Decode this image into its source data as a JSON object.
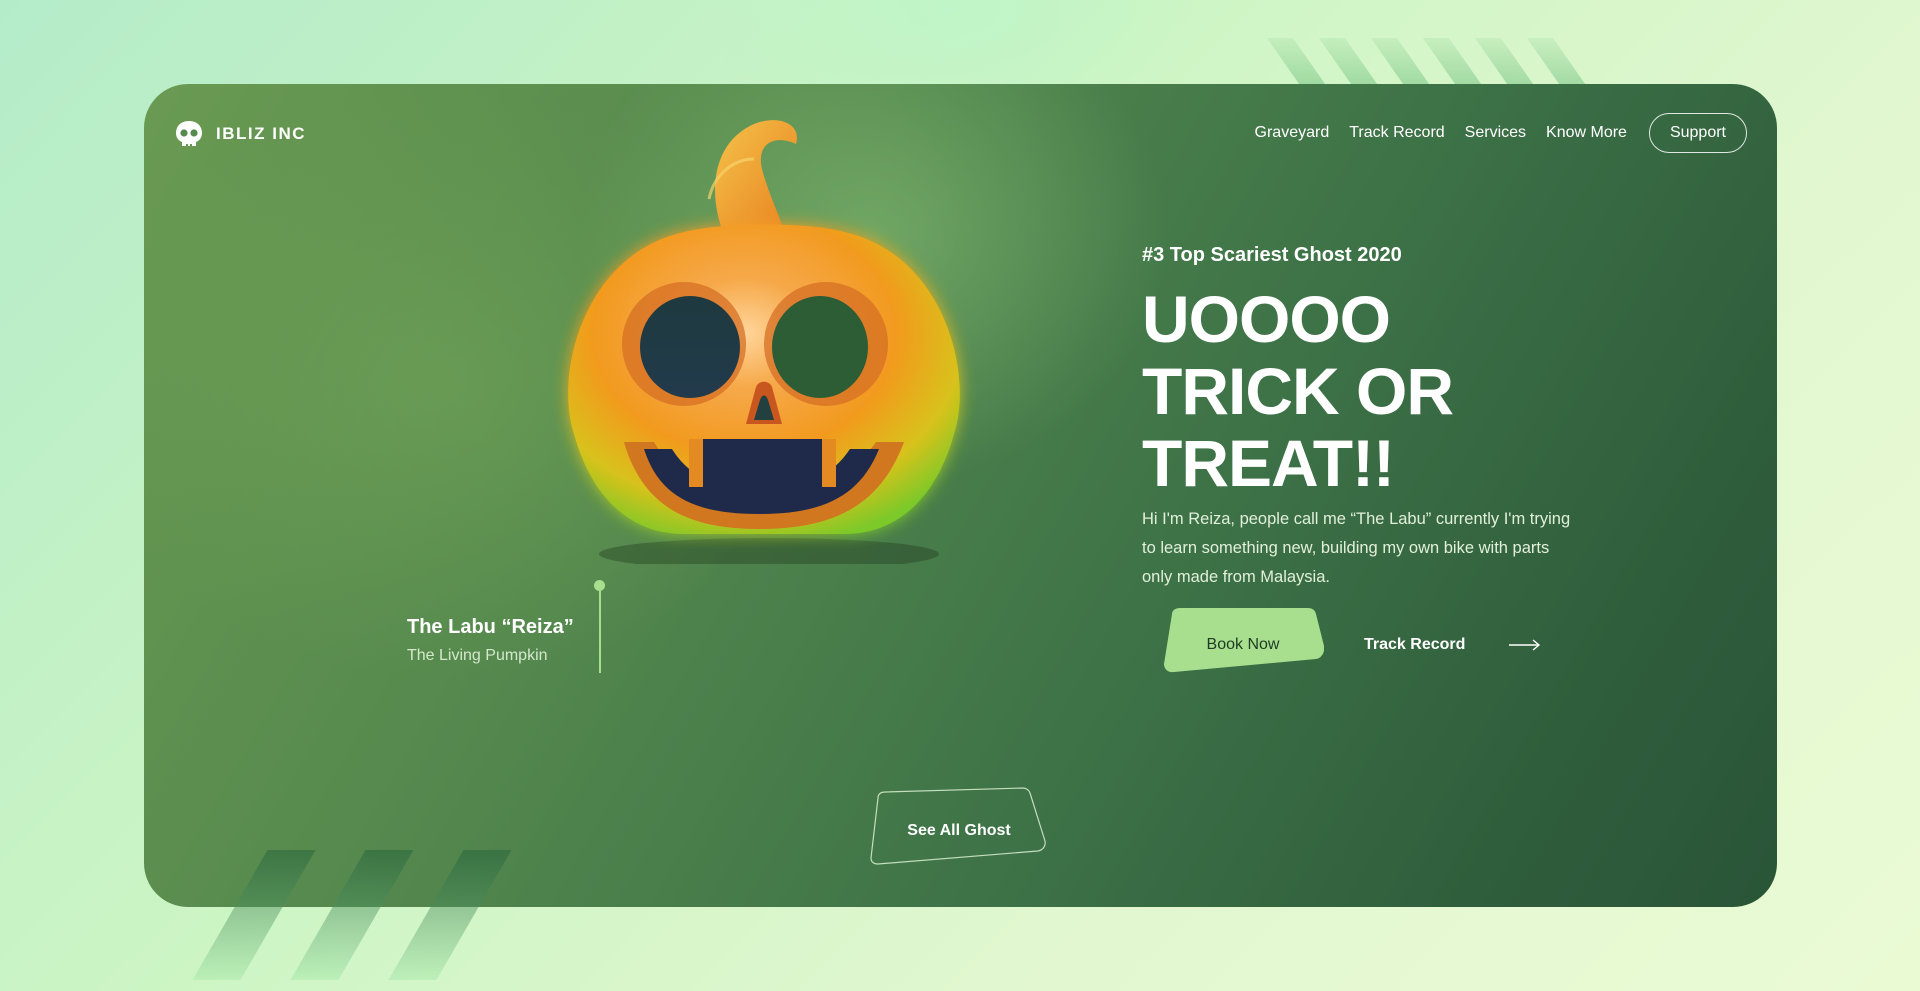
{
  "brand": {
    "name": "IBLIZ INC",
    "logo_icon": "skull-icon"
  },
  "nav": {
    "links": [
      "Graveyard",
      "Track Record",
      "Services",
      "Know More"
    ],
    "support_label": "Support"
  },
  "caption": {
    "title": "The Labu “Reiza”",
    "subtitle": "The Living Pumpkin"
  },
  "hero": {
    "eyebrow": "#3 Top Scariest Ghost 2020",
    "headline_lines": [
      "UOOOO",
      "TRICK OR",
      "TREAT!!"
    ],
    "description": "Hi I'm Reiza, people call me “The Labu” currently I'm trying to learn something new, building my own bike with parts only made from Malaysia.",
    "book_label": "Book Now",
    "track_label": "Track Record",
    "track_icon": "arrow-right-icon"
  },
  "footer_cta": {
    "see_all_label": "See All Ghost"
  },
  "colors": {
    "accent": "#a7df8f",
    "card_dark": "#2a5538",
    "card_light": "#6a9a52",
    "pumpkin_orange": "#f2a122"
  }
}
